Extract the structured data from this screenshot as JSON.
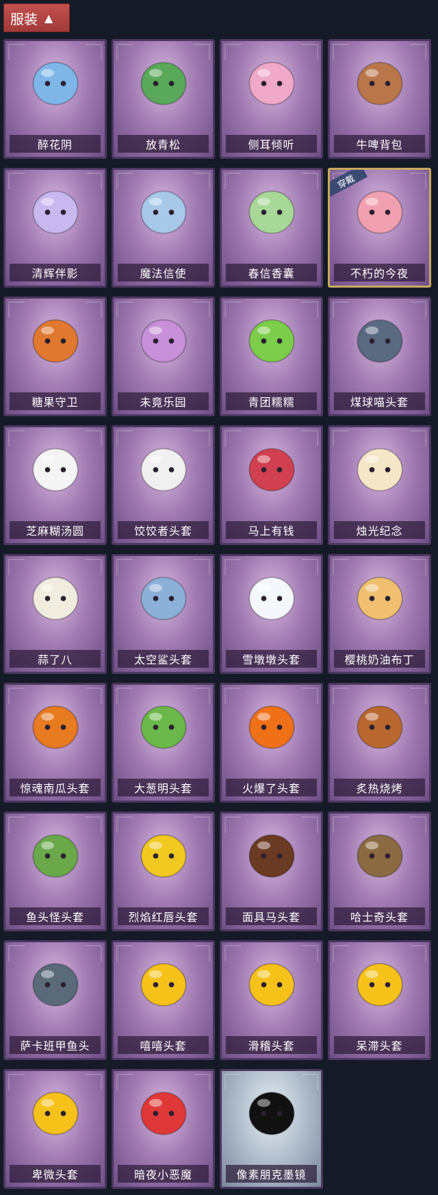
{
  "header": {
    "title": "服装",
    "chevron_icon": "chevron-up-icon"
  },
  "badges": {
    "equipped": "穿戴"
  },
  "items": [
    {
      "name": "醉花阴",
      "icon": "floral-dreamcatcher-icon",
      "color": "#7fb6e8"
    },
    {
      "name": "放青松",
      "icon": "potted-pine-icon",
      "color": "#5aa85a"
    },
    {
      "name": "侧耳倾听",
      "icon": "lotus-wreath-icon",
      "color": "#f0a8c8"
    },
    {
      "name": "牛啤背包",
      "icon": "cow-beer-barrel-icon",
      "color": "#b9764a"
    },
    {
      "name": "清辉伴影",
      "icon": "moon-girl-figure-icon",
      "color": "#c8b8f0"
    },
    {
      "name": "魔法信使",
      "icon": "elephant-mage-icon",
      "color": "#a8c8e8"
    },
    {
      "name": "春信香囊",
      "icon": "green-sachet-icon",
      "color": "#a8d898"
    },
    {
      "name": "不朽的今夜",
      "icon": "fox-bowl-icon",
      "color": "#f0a0b0",
      "equipped": true
    },
    {
      "name": "糖果守卫",
      "icon": "pumpkin-scarecrow-icon",
      "color": "#e07830"
    },
    {
      "name": "未竟乐园",
      "icon": "clown-girl-icon",
      "color": "#c890d8"
    },
    {
      "name": "青团糯糯",
      "icon": "green-mochi-icon",
      "color": "#7ccd4a"
    },
    {
      "name": "煤球喵头套",
      "icon": "black-cat-head-icon",
      "color": "#5a6a80"
    },
    {
      "name": "芝麻糊汤圆",
      "icon": "white-dumpling-icon",
      "color": "#f4f4f4"
    },
    {
      "name": "饺饺者头套",
      "icon": "cloud-dumpling-icon",
      "color": "#f0f0f0"
    },
    {
      "name": "马上有钱",
      "icon": "red-horse-head-icon",
      "color": "#d04050"
    },
    {
      "name": "烛光纪念",
      "icon": "candle-head-icon",
      "color": "#f6e6c8"
    },
    {
      "name": "蒜了八",
      "icon": "garlic-head-icon",
      "color": "#f0ece0"
    },
    {
      "name": "太空鲨头套",
      "icon": "shark-head-icon",
      "color": "#8cb0d8"
    },
    {
      "name": "雪墩墩头套",
      "icon": "snowman-head-icon",
      "color": "#f4f8fc"
    },
    {
      "name": "樱桃奶油布丁",
      "icon": "pudding-head-icon",
      "color": "#f0c070"
    },
    {
      "name": "惊魂南瓜头套",
      "icon": "jack-o-lantern-icon",
      "color": "#e87a20"
    },
    {
      "name": "大葱明头套",
      "icon": "scallion-head-icon",
      "color": "#6ab84a"
    },
    {
      "name": "火爆了头套",
      "icon": "fire-head-icon",
      "color": "#f07018"
    },
    {
      "name": "炙热烧烤",
      "icon": "bbq-meat-icon",
      "color": "#b8682e"
    },
    {
      "name": "鱼头怪头套",
      "icon": "fish-monster-head-icon",
      "color": "#6aa84a"
    },
    {
      "name": "烈焰红唇头套",
      "icon": "yellow-mouse-sunglasses-icon",
      "color": "#f0c820"
    },
    {
      "name": "面具马头套",
      "icon": "horse-mask-icon",
      "color": "#6a3a22"
    },
    {
      "name": "哈士奇头套",
      "icon": "husky-sunglasses-icon",
      "color": "#8a6a40"
    },
    {
      "name": "萨卡班甲鱼头",
      "icon": "sacabambaspis-head-icon",
      "color": "#5a6a78"
    },
    {
      "name": "嘻嘻头套",
      "icon": "grin-emoji-icon",
      "color": "#f6c21a"
    },
    {
      "name": "滑稽头套",
      "icon": "smirk-emoji-icon",
      "color": "#f6c21a"
    },
    {
      "name": "呆滞头套",
      "icon": "dazed-emoji-icon",
      "color": "#f6c21a"
    },
    {
      "name": "卑微头套",
      "icon": "humble-emoji-icon",
      "color": "#f6c21a"
    },
    {
      "name": "暗夜小恶魔",
      "icon": "little-devil-icon",
      "color": "#e03838"
    },
    {
      "name": "像素朋克墨镜",
      "icon": "pixel-sunglasses-icon",
      "color": "#111111",
      "special": true
    }
  ]
}
